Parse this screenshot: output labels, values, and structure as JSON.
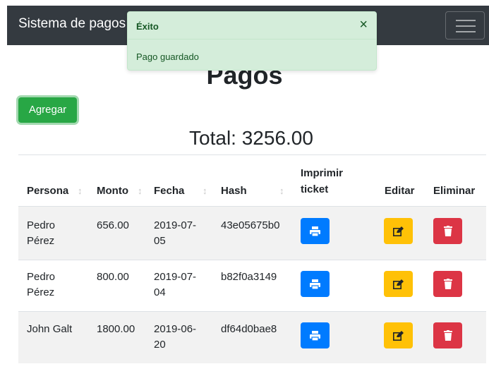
{
  "navbar": {
    "brand": "Sistema de pagos"
  },
  "toast": {
    "title": "Éxito",
    "close": "×",
    "message": "Pago guardado"
  },
  "page": {
    "title": "Pagos",
    "add_label": "Agregar",
    "total_text": "Total: 3256.00"
  },
  "table": {
    "headers": {
      "persona": "Persona",
      "monto": "Monto",
      "fecha": "Fecha",
      "hash": "Hash",
      "imprimir_line1": "Imprimir",
      "imprimir_line2": "ticket",
      "editar": "Editar",
      "eliminar": "Eliminar"
    },
    "sort_glyph": "↕",
    "rows": [
      {
        "persona_l1": "Pedro",
        "persona_l2": "Pérez",
        "monto": "656.00",
        "fecha_l1": "2019-07-",
        "fecha_l2": "05",
        "hash": "43e05675b0"
      },
      {
        "persona_l1": "Pedro",
        "persona_l2": "Pérez",
        "monto": "800.00",
        "fecha_l1": "2019-07-",
        "fecha_l2": "04",
        "hash": "b82f0a3149"
      },
      {
        "persona_l1": "John Galt",
        "persona_l2": "",
        "monto": "1800.00",
        "fecha_l1": "2019-06-",
        "fecha_l2": "20",
        "hash": "df64d0bae8"
      }
    ]
  },
  "icons": {
    "print": "print-icon",
    "edit": "edit-icon",
    "delete": "trash-icon",
    "menu": "hamburger-icon",
    "sort": "sort-icon"
  },
  "colors": {
    "navbar": "#343a40",
    "success": "#28a745",
    "primary": "#007bff",
    "warning": "#ffc107",
    "danger": "#dc3545",
    "toast_bg": "#d4edda"
  }
}
